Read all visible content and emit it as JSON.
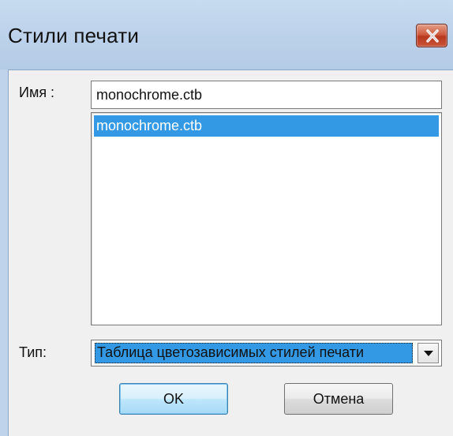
{
  "window": {
    "title": "Стили печати"
  },
  "form": {
    "name_label": "Имя :",
    "name_value": "monochrome.ctb",
    "list_items": [
      "monochrome.ctb"
    ],
    "type_label": "Тип:",
    "type_value": "Таблица цветозависимых стилей печати"
  },
  "buttons": {
    "ok": "OK",
    "cancel": "Отмена"
  },
  "icons": {
    "close": "close-icon",
    "dropdown": "chevron-down-icon"
  },
  "colors": {
    "titlebar": "#bfd4ea",
    "close_button": "#c9553a",
    "selection": "#3399e5",
    "dialog_background": "#f0f0f0"
  }
}
